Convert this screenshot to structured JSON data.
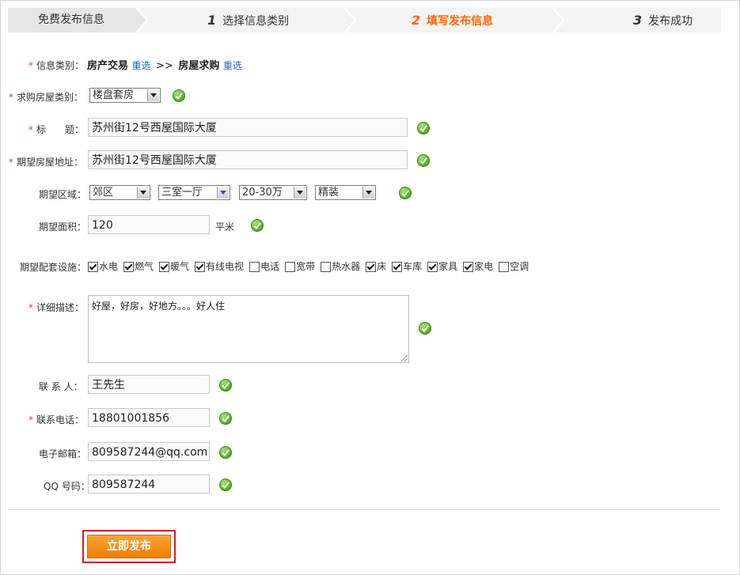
{
  "steps": [
    {
      "num": "",
      "label": "免费发布信息"
    },
    {
      "num": "1",
      "label": "选择信息类别"
    },
    {
      "num": "2",
      "label": "填写发布信息"
    },
    {
      "num": "3",
      "label": "发布成功"
    }
  ],
  "category": {
    "label": "信息类别：",
    "primary": "房产交易",
    "reselect1": "重选",
    "sep": ">>",
    "secondary": "房屋求购",
    "reselect2": "重选"
  },
  "house_type": {
    "label": "求购房屋类别：",
    "value": "楼盘套房"
  },
  "title": {
    "label": "标　　题：",
    "value": "苏州街12号西屋国际大厦"
  },
  "address": {
    "label": "期望房屋地址：",
    "value": "苏州街12号西屋国际大厦"
  },
  "area_region": {
    "label": "期望区域：",
    "district": "郊区",
    "rooms": "三室一厅",
    "price": "20-30万",
    "decoration": "精装"
  },
  "size": {
    "label": "期望面积：",
    "value": "120",
    "unit": "平米"
  },
  "facilities": {
    "label": "期望配套设施：",
    "items": [
      {
        "label": "水电",
        "checked": true
      },
      {
        "label": "燃气",
        "checked": true
      },
      {
        "label": "暖气",
        "checked": true
      },
      {
        "label": "有线电视",
        "checked": true
      },
      {
        "label": "电话",
        "checked": false
      },
      {
        "label": "宽带",
        "checked": false
      },
      {
        "label": "热水器",
        "checked": false
      },
      {
        "label": "床",
        "checked": true
      },
      {
        "label": "车库",
        "checked": true
      },
      {
        "label": "家具",
        "checked": true
      },
      {
        "label": "家电",
        "checked": true
      },
      {
        "label": "空调",
        "checked": false
      }
    ]
  },
  "description": {
    "label": "详细描述：",
    "value": "好屋，好房，好地方。。。好人住"
  },
  "contact": {
    "label": "联 系 人：",
    "value": "王先生"
  },
  "phone": {
    "label": "联系电话：",
    "value": "18801001856"
  },
  "email": {
    "label": "电子邮箱：",
    "value": "809587244@qq.com"
  },
  "qq": {
    "label": "QQ 号码：",
    "value": "809587244"
  },
  "required_mark": "*",
  "submit_label": "立即发布",
  "colors": {
    "accent": "#ff6600",
    "ok_green": "#4ea81f",
    "link": "#1a66c3",
    "required": "#e4393c"
  }
}
